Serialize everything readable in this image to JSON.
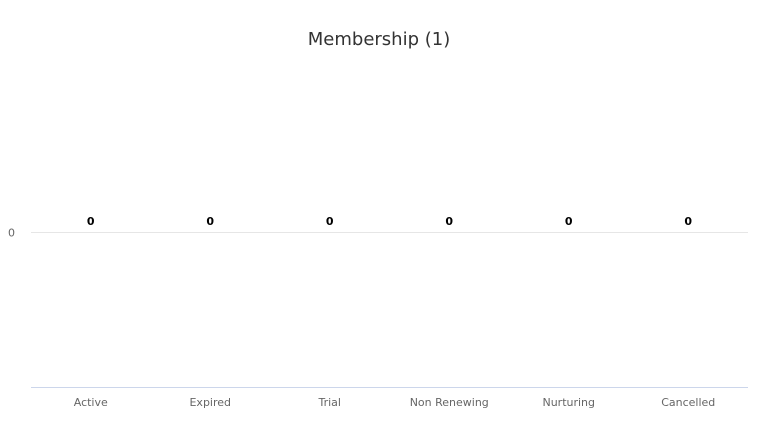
{
  "chart_data": {
    "type": "bar",
    "title": "Membership (1)",
    "categories": [
      "Active",
      "Expired",
      "Trial",
      "Non Renewing",
      "Nurturing",
      "Cancelled"
    ],
    "values": [
      0,
      0,
      0,
      0,
      0,
      0
    ],
    "y_tick_labels": [
      "0"
    ],
    "xlabel": "",
    "ylabel": "",
    "grid": false,
    "legend": "none",
    "colors": {
      "axis_line": "#ccd6eb",
      "zero_line": "#e6e6e6",
      "tick_label": "#666666",
      "data_label": "#000000",
      "title": "#333333"
    }
  }
}
